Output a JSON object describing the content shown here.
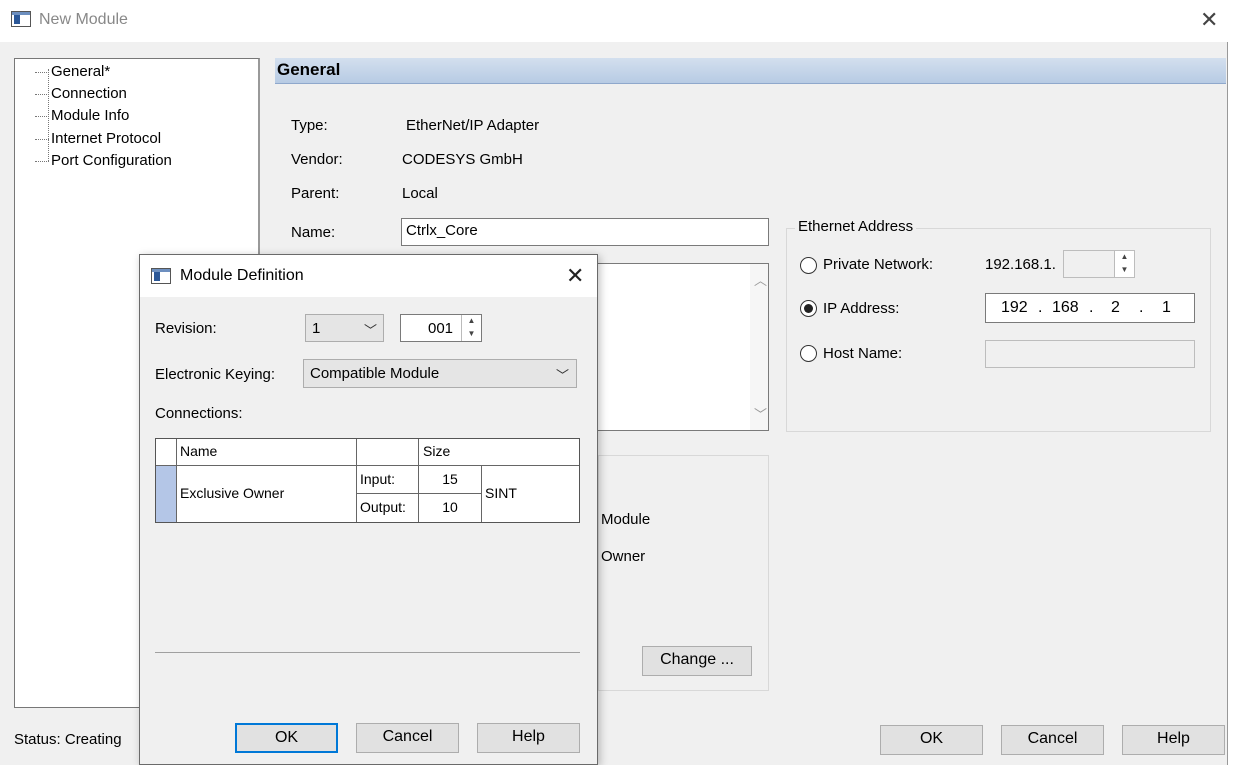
{
  "window": {
    "title": "New Module",
    "close_glyph": "✕",
    "icon": "window-icon"
  },
  "tree": {
    "items": [
      "General*",
      "Connection",
      "Module Info",
      "Internet Protocol",
      "Port Configuration"
    ]
  },
  "general": {
    "header": "General",
    "type_label": "Type:",
    "type_value": "EtherNet/IP Adapter",
    "vendor_label": "Vendor:",
    "vendor_value": "CODESYS GmbH",
    "parent_label": "Parent:",
    "parent_value": "Local",
    "name_label": "Name:",
    "name_value": "Ctrlx_Core",
    "partial_module": "Module",
    "partial_owner": "Owner",
    "change_button": "Change ..."
  },
  "ethernet": {
    "title": "Ethernet Address",
    "private_label": "Private Network:",
    "private_prefix": "192.168.1.",
    "ip_label": "IP Address:",
    "ip_octets": [
      "192",
      "168",
      "2",
      "1"
    ],
    "ip_sep": ".",
    "host_label": "Host Name:",
    "selected": "ip"
  },
  "status": {
    "text": "Status:  Creating"
  },
  "footer": {
    "ok": "OK",
    "cancel": "Cancel",
    "help": "Help"
  },
  "dialog": {
    "title": "Module Definition",
    "close_glyph": "✕",
    "revision_label": "Revision:",
    "revision_major": "1",
    "revision_minor": "001",
    "keying_label": "Electronic Keying:",
    "keying_value": "Compatible Module",
    "connections_label": "Connections:",
    "table": {
      "col_name": "Name",
      "col_blank": "",
      "col_size": "Size",
      "row_name": "Exclusive Owner",
      "input_label": "Input:",
      "input_size": "15",
      "output_label": "Output:",
      "output_size": "10",
      "type": "SINT"
    },
    "ok": "OK",
    "cancel": "Cancel",
    "help": "Help"
  },
  "colors": {
    "accent": "#0078d7",
    "header_gradient_top": "#d3dfee",
    "header_gradient_bottom": "#b7cbe4",
    "row_selector": "#b4c6e7"
  }
}
